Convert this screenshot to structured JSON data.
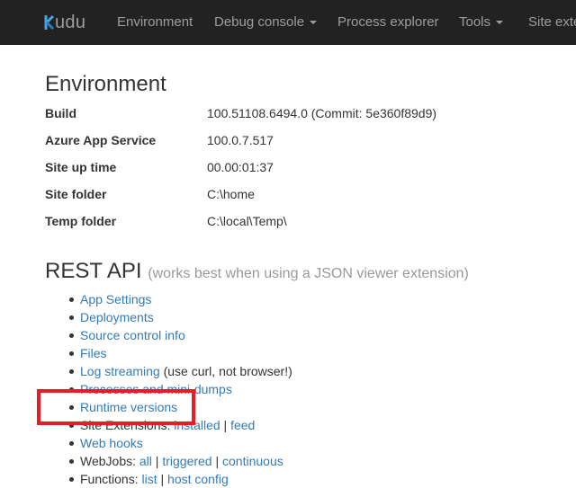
{
  "navbar": {
    "brand": "Kudu",
    "items": [
      {
        "label": "Environment",
        "dropdown": false
      },
      {
        "label": "Debug console",
        "dropdown": true
      },
      {
        "label": "Process explorer",
        "dropdown": false
      },
      {
        "label": "Tools",
        "dropdown": true
      },
      {
        "label": "Site exte",
        "dropdown": false
      }
    ]
  },
  "environment": {
    "title": "Environment",
    "rows": [
      {
        "key": "Build",
        "value": "100.51108.6494.0 (Commit: 5e360f89d9)"
      },
      {
        "key": "Azure App Service",
        "value": "100.0.7.517"
      },
      {
        "key": "Site up time",
        "value": "00.00:01:37"
      },
      {
        "key": "Site folder",
        "value": "C:\\home"
      },
      {
        "key": "Temp folder",
        "value": "C:\\local\\Temp\\"
      }
    ]
  },
  "rest_api": {
    "title": "REST API",
    "note": "(works best when using a JSON viewer extension)",
    "app_settings": "App Settings",
    "deployments": "Deployments",
    "source_control_info": "Source control info",
    "files": "Files",
    "log_streaming": "Log streaming",
    "log_streaming_note": " (use curl, not browser!)",
    "processes": "Processes and mini-dumps",
    "runtime_versions": "Runtime versions",
    "site_extensions_label": "Site Extensions: ",
    "site_extensions_installed": "installed",
    "separator": " | ",
    "site_extensions_feed": "feed",
    "web_hooks": "Web hooks",
    "webjobs_label": "WebJobs: ",
    "webjobs_all": "all",
    "webjobs_triggered": "triggered",
    "webjobs_continuous": "continuous",
    "functions_label": "Functions: ",
    "functions_list": "list",
    "functions_host_config": "host config"
  },
  "colors": {
    "navbar_bg": "#222222",
    "nav_text": "#9d9d9d",
    "link": "#337ab7",
    "highlight_box": "#e81d24"
  }
}
